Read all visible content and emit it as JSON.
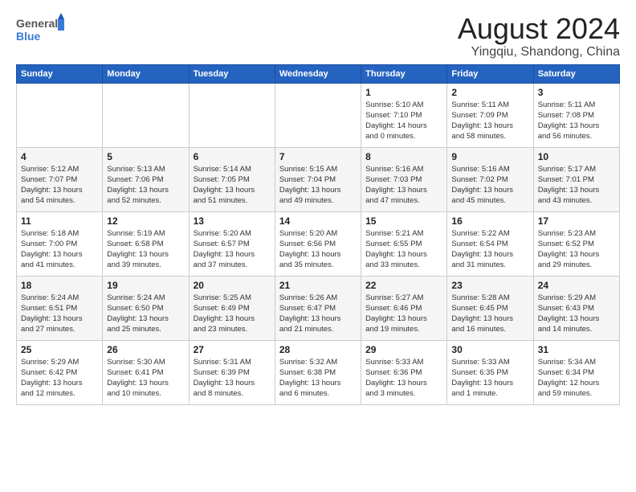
{
  "logo": {
    "general": "General",
    "blue": "Blue"
  },
  "title": "August 2024",
  "location": "Yingqiu, Shandong, China",
  "days_of_week": [
    "Sunday",
    "Monday",
    "Tuesday",
    "Wednesday",
    "Thursday",
    "Friday",
    "Saturday"
  ],
  "weeks": [
    [
      {
        "day": "",
        "info": ""
      },
      {
        "day": "",
        "info": ""
      },
      {
        "day": "",
        "info": ""
      },
      {
        "day": "",
        "info": ""
      },
      {
        "day": "1",
        "info": "Sunrise: 5:10 AM\nSunset: 7:10 PM\nDaylight: 14 hours\nand 0 minutes."
      },
      {
        "day": "2",
        "info": "Sunrise: 5:11 AM\nSunset: 7:09 PM\nDaylight: 13 hours\nand 58 minutes."
      },
      {
        "day": "3",
        "info": "Sunrise: 5:11 AM\nSunset: 7:08 PM\nDaylight: 13 hours\nand 56 minutes."
      }
    ],
    [
      {
        "day": "4",
        "info": "Sunrise: 5:12 AM\nSunset: 7:07 PM\nDaylight: 13 hours\nand 54 minutes."
      },
      {
        "day": "5",
        "info": "Sunrise: 5:13 AM\nSunset: 7:06 PM\nDaylight: 13 hours\nand 52 minutes."
      },
      {
        "day": "6",
        "info": "Sunrise: 5:14 AM\nSunset: 7:05 PM\nDaylight: 13 hours\nand 51 minutes."
      },
      {
        "day": "7",
        "info": "Sunrise: 5:15 AM\nSunset: 7:04 PM\nDaylight: 13 hours\nand 49 minutes."
      },
      {
        "day": "8",
        "info": "Sunrise: 5:16 AM\nSunset: 7:03 PM\nDaylight: 13 hours\nand 47 minutes."
      },
      {
        "day": "9",
        "info": "Sunrise: 5:16 AM\nSunset: 7:02 PM\nDaylight: 13 hours\nand 45 minutes."
      },
      {
        "day": "10",
        "info": "Sunrise: 5:17 AM\nSunset: 7:01 PM\nDaylight: 13 hours\nand 43 minutes."
      }
    ],
    [
      {
        "day": "11",
        "info": "Sunrise: 5:18 AM\nSunset: 7:00 PM\nDaylight: 13 hours\nand 41 minutes."
      },
      {
        "day": "12",
        "info": "Sunrise: 5:19 AM\nSunset: 6:58 PM\nDaylight: 13 hours\nand 39 minutes."
      },
      {
        "day": "13",
        "info": "Sunrise: 5:20 AM\nSunset: 6:57 PM\nDaylight: 13 hours\nand 37 minutes."
      },
      {
        "day": "14",
        "info": "Sunrise: 5:20 AM\nSunset: 6:56 PM\nDaylight: 13 hours\nand 35 minutes."
      },
      {
        "day": "15",
        "info": "Sunrise: 5:21 AM\nSunset: 6:55 PM\nDaylight: 13 hours\nand 33 minutes."
      },
      {
        "day": "16",
        "info": "Sunrise: 5:22 AM\nSunset: 6:54 PM\nDaylight: 13 hours\nand 31 minutes."
      },
      {
        "day": "17",
        "info": "Sunrise: 5:23 AM\nSunset: 6:52 PM\nDaylight: 13 hours\nand 29 minutes."
      }
    ],
    [
      {
        "day": "18",
        "info": "Sunrise: 5:24 AM\nSunset: 6:51 PM\nDaylight: 13 hours\nand 27 minutes."
      },
      {
        "day": "19",
        "info": "Sunrise: 5:24 AM\nSunset: 6:50 PM\nDaylight: 13 hours\nand 25 minutes."
      },
      {
        "day": "20",
        "info": "Sunrise: 5:25 AM\nSunset: 6:49 PM\nDaylight: 13 hours\nand 23 minutes."
      },
      {
        "day": "21",
        "info": "Sunrise: 5:26 AM\nSunset: 6:47 PM\nDaylight: 13 hours\nand 21 minutes."
      },
      {
        "day": "22",
        "info": "Sunrise: 5:27 AM\nSunset: 6:46 PM\nDaylight: 13 hours\nand 19 minutes."
      },
      {
        "day": "23",
        "info": "Sunrise: 5:28 AM\nSunset: 6:45 PM\nDaylight: 13 hours\nand 16 minutes."
      },
      {
        "day": "24",
        "info": "Sunrise: 5:29 AM\nSunset: 6:43 PM\nDaylight: 13 hours\nand 14 minutes."
      }
    ],
    [
      {
        "day": "25",
        "info": "Sunrise: 5:29 AM\nSunset: 6:42 PM\nDaylight: 13 hours\nand 12 minutes."
      },
      {
        "day": "26",
        "info": "Sunrise: 5:30 AM\nSunset: 6:41 PM\nDaylight: 13 hours\nand 10 minutes."
      },
      {
        "day": "27",
        "info": "Sunrise: 5:31 AM\nSunset: 6:39 PM\nDaylight: 13 hours\nand 8 minutes."
      },
      {
        "day": "28",
        "info": "Sunrise: 5:32 AM\nSunset: 6:38 PM\nDaylight: 13 hours\nand 6 minutes."
      },
      {
        "day": "29",
        "info": "Sunrise: 5:33 AM\nSunset: 6:36 PM\nDaylight: 13 hours\nand 3 minutes."
      },
      {
        "day": "30",
        "info": "Sunrise: 5:33 AM\nSunset: 6:35 PM\nDaylight: 13 hours\nand 1 minute."
      },
      {
        "day": "31",
        "info": "Sunrise: 5:34 AM\nSunset: 6:34 PM\nDaylight: 12 hours\nand 59 minutes."
      }
    ]
  ]
}
